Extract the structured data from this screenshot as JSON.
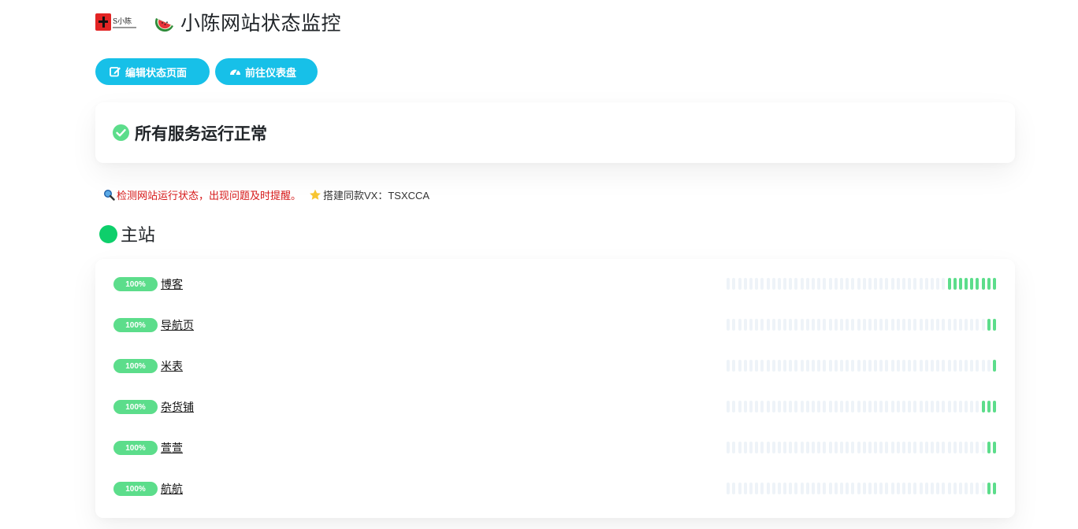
{
  "header": {
    "logo_text": "S小陈",
    "title": "小陈网站状态监控"
  },
  "buttons": [
    {
      "label": "编辑状态页面",
      "icon": "edit-icon"
    },
    {
      "label": "前往仪表盘",
      "icon": "dashboard-icon"
    }
  ],
  "overall_status": {
    "text": "所有服务运行正常",
    "icon": "check-circle-icon",
    "color": "#5cdd8b"
  },
  "description": {
    "red_text": "检测网站运行状态，出现问题及时提醒。",
    "extra_text": "搭建同款VX：TSXCCA"
  },
  "group": {
    "title": "主站",
    "status_color": "#0ecf6b"
  },
  "monitors": [
    {
      "uptime": "100%",
      "name": "博客",
      "up_beats": 9
    },
    {
      "uptime": "100%",
      "name": "导航页",
      "up_beats": 2
    },
    {
      "uptime": "100%",
      "name": "米表",
      "up_beats": 1
    },
    {
      "uptime": "100%",
      "name": "杂货铺",
      "up_beats": 3
    },
    {
      "uptime": "100%",
      "name": "萱萱",
      "up_beats": 2
    },
    {
      "uptime": "100%",
      "name": "航航",
      "up_beats": 2
    }
  ],
  "colors": {
    "accent": "#17c0e8",
    "up": "#5cdd8b",
    "empty": "#eef3f8",
    "alert_text": "#d61818"
  }
}
